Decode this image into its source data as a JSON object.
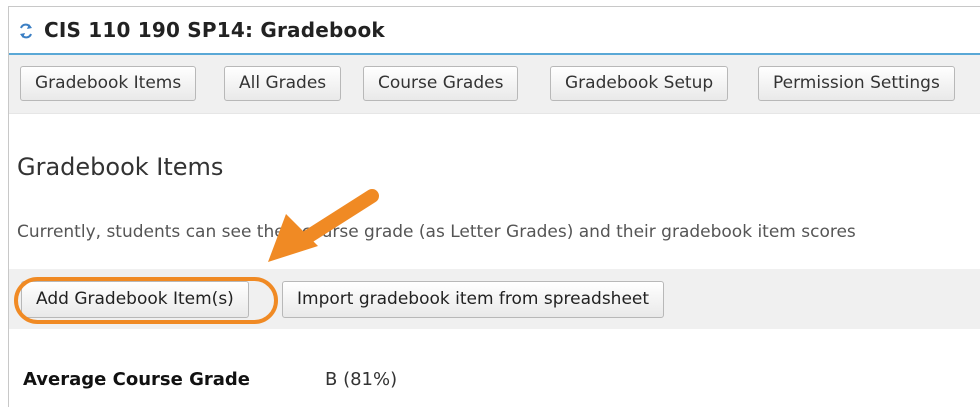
{
  "site": {
    "title": "CIS 110 190 SP14: Gradebook",
    "icon": "reset-icon"
  },
  "nav": {
    "tabs": [
      {
        "label": "Gradebook Items"
      },
      {
        "label": "All Grades"
      },
      {
        "label": "Course Grades"
      },
      {
        "label": "Gradebook Setup"
      },
      {
        "label": "Permission Settings"
      }
    ]
  },
  "main": {
    "heading": "Gradebook Items",
    "info": "Currently, students can see their course grade (as Letter Grades) and their gradebook item scores",
    "actions": {
      "add_label": "Add Gradebook Item(s)",
      "import_label": "Import gradebook item from spreadsheet"
    },
    "summary": {
      "label": "Average Course Grade",
      "value": "B (81%)"
    }
  },
  "annotation": {
    "color": "#f08a24"
  }
}
